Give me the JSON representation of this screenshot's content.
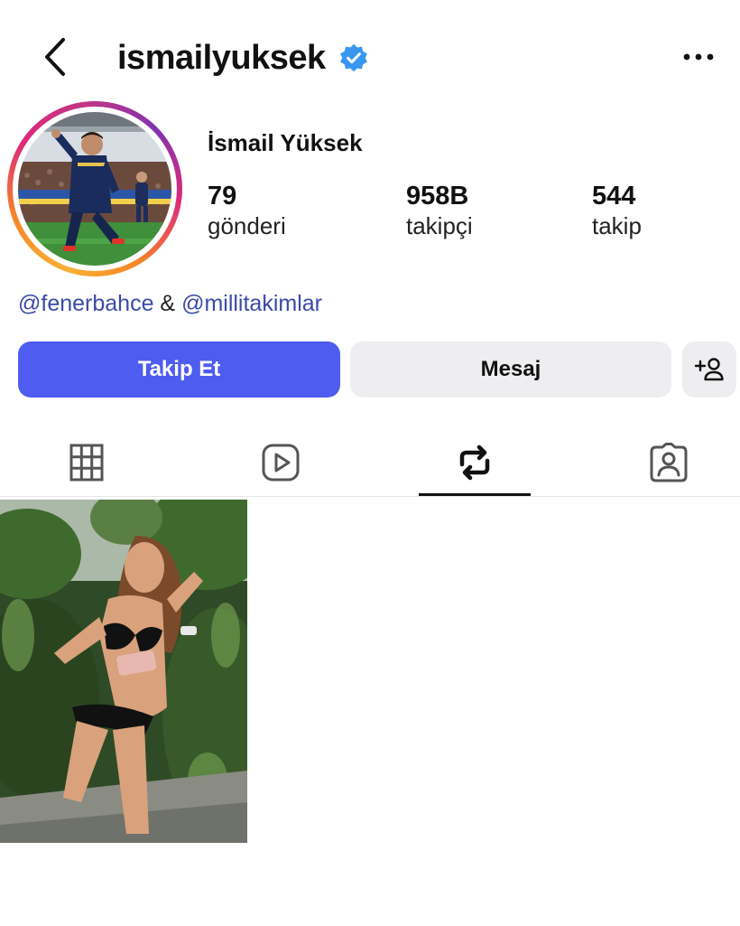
{
  "header": {
    "back_icon": "chevron-left-icon",
    "username": "ismailyuksek",
    "verified_icon": "verified-badge-icon",
    "more_icon": "more-horizontal-icon"
  },
  "profile": {
    "full_name": "İsmail Yüksek",
    "stats": [
      {
        "value": "79",
        "label": "gönderi"
      },
      {
        "value": "958B",
        "label": "takipçi"
      },
      {
        "value": "544",
        "label": "takip"
      }
    ],
    "bio": {
      "mention1": "@fenerbahce",
      "joiner": " & ",
      "mention2": "@millitakimlar"
    }
  },
  "actions": {
    "follow_label": "Takip Et",
    "message_label": "Mesaj",
    "add_user_icon": "add-user-icon"
  },
  "tabs": [
    {
      "icon": "grid-icon"
    },
    {
      "icon": "reels-icon"
    },
    {
      "icon": "repost-icon",
      "active": true
    },
    {
      "icon": "tagged-icon"
    }
  ],
  "colors": {
    "follow_button": "#4e5cf0",
    "secondary_button": "#eeeef0",
    "mention": "#3b4aa8",
    "verified": "#3897f0"
  }
}
